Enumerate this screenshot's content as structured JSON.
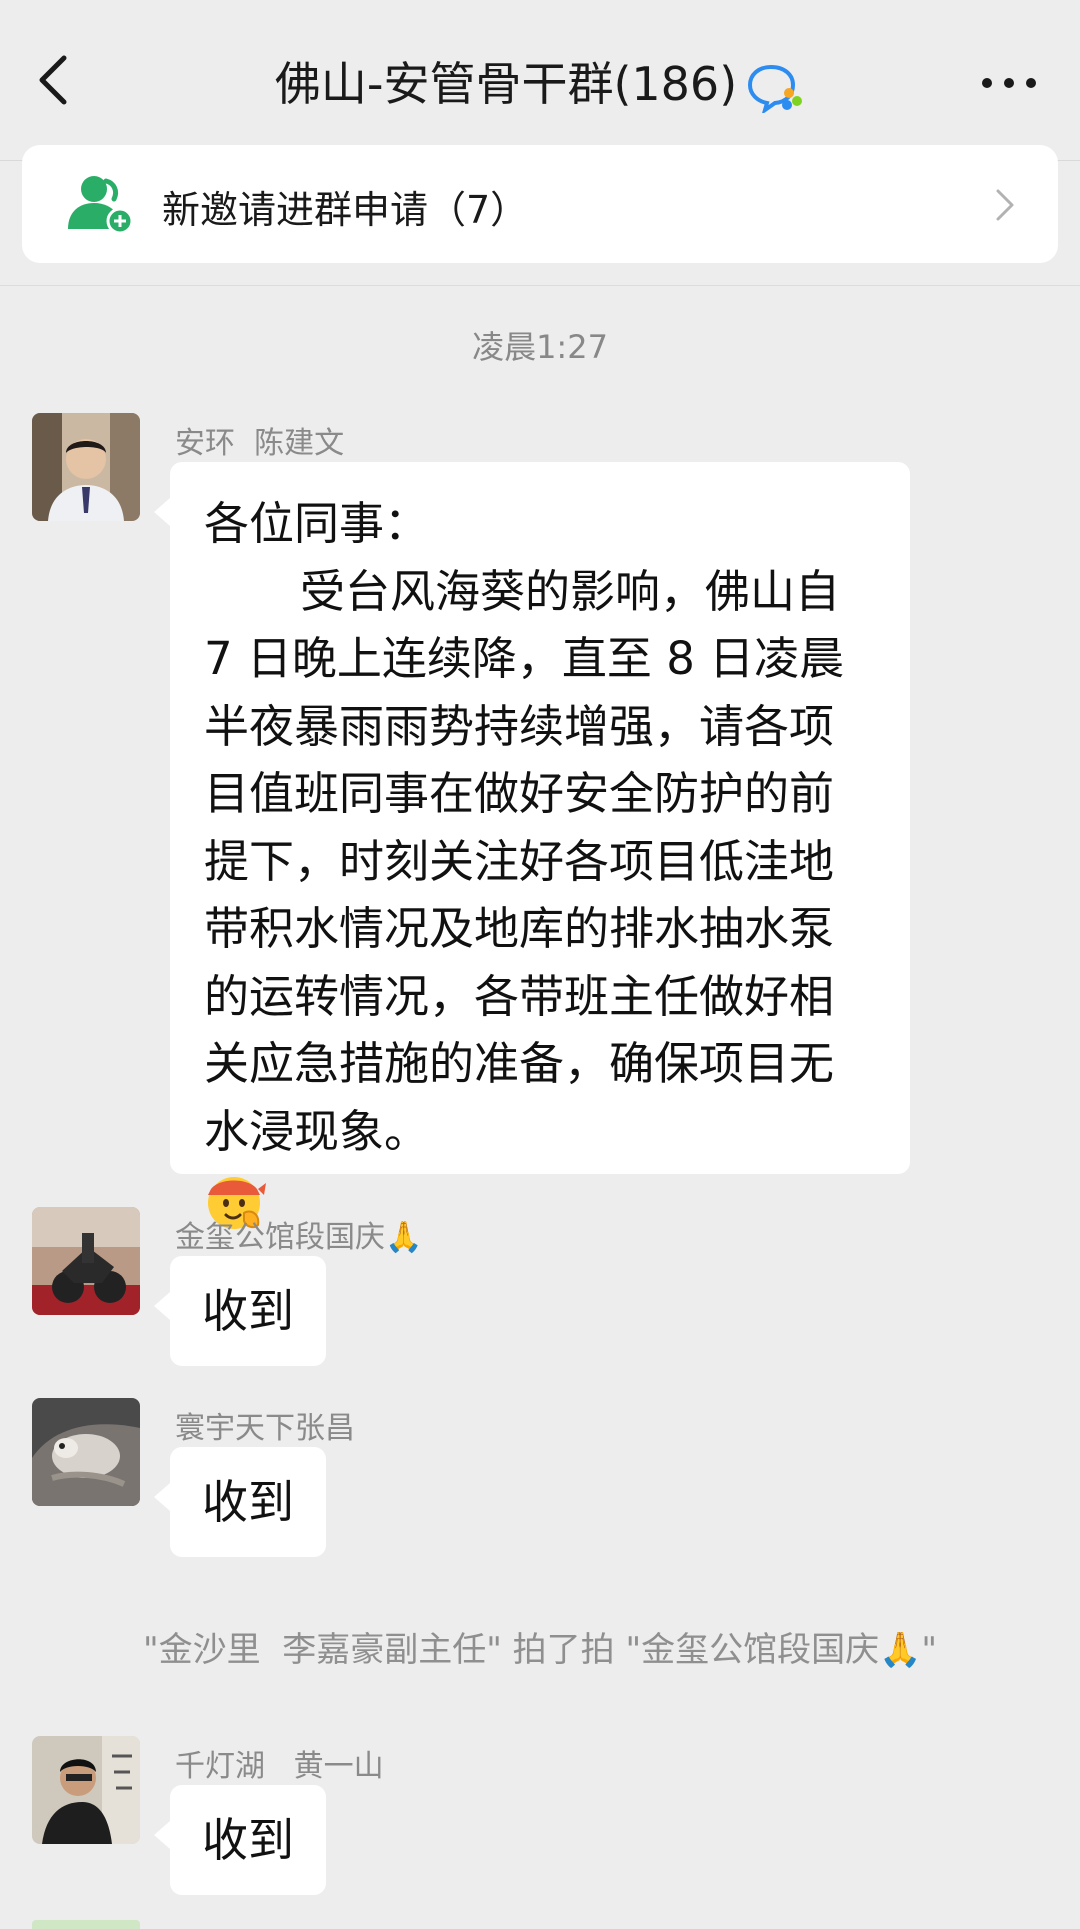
{
  "header": {
    "title": "佛山-安管骨干群(186)",
    "back_icon": "chevron-left-icon",
    "more_icon": "ellipsis-icon"
  },
  "invite": {
    "label": "新邀请进群申请（7）",
    "icon": "add-user-icon"
  },
  "timestamp": "凌晨1:27",
  "messages": [
    {
      "sender": "安环  陈建文",
      "lines": [
        "各位同事：",
        "受台风海葵的影响，佛山自 7 日晚上连续降，直至 8 日凌晨半夜暴雨雨势持续增强，请各项目值班同事在做好安全防护的前提下，时刻关注好各项目低洼地带积水情况及地库的排水抽水泵的运转情况，各带班主任做好相关应急措施的准备，确保项目无水浸现象。"
      ],
      "emoji": "saluting-face-emoji"
    },
    {
      "sender": "金玺公馆段国庆🙏",
      "text": "收到"
    },
    {
      "sender": "寰宇天下张昌",
      "text": "收到"
    },
    {
      "sender": "千灯湖   黄一山",
      "text": "收到"
    }
  ],
  "system_notice": "\"金沙里  李嘉豪副主任\" 拍了拍 \"金玺公馆段国庆🙏\"",
  "colors": {
    "background": "#ededed",
    "bubble": "#ffffff",
    "invite_icon": "#2aae67"
  }
}
